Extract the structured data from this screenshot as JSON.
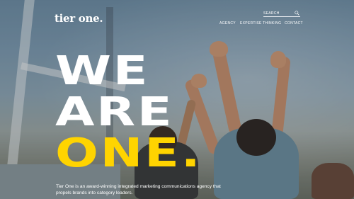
{
  "brand": {
    "logo": "tier one."
  },
  "search": {
    "placeholder": "SEARCH",
    "icon": "search-icon"
  },
  "nav": {
    "items": [
      {
        "label": "AGENCY"
      },
      {
        "label": "EXPERTISE"
      },
      {
        "label": "THINKING"
      },
      {
        "label": "CONTACT"
      }
    ]
  },
  "hero": {
    "lines": [
      "WE",
      "ARE",
      "ONE."
    ],
    "accent_color": "#ffd400",
    "text_color": "#ffffff"
  },
  "tagline": "Tier One is an award-winning integrated marketing communications agency that propels brands into category leaders."
}
